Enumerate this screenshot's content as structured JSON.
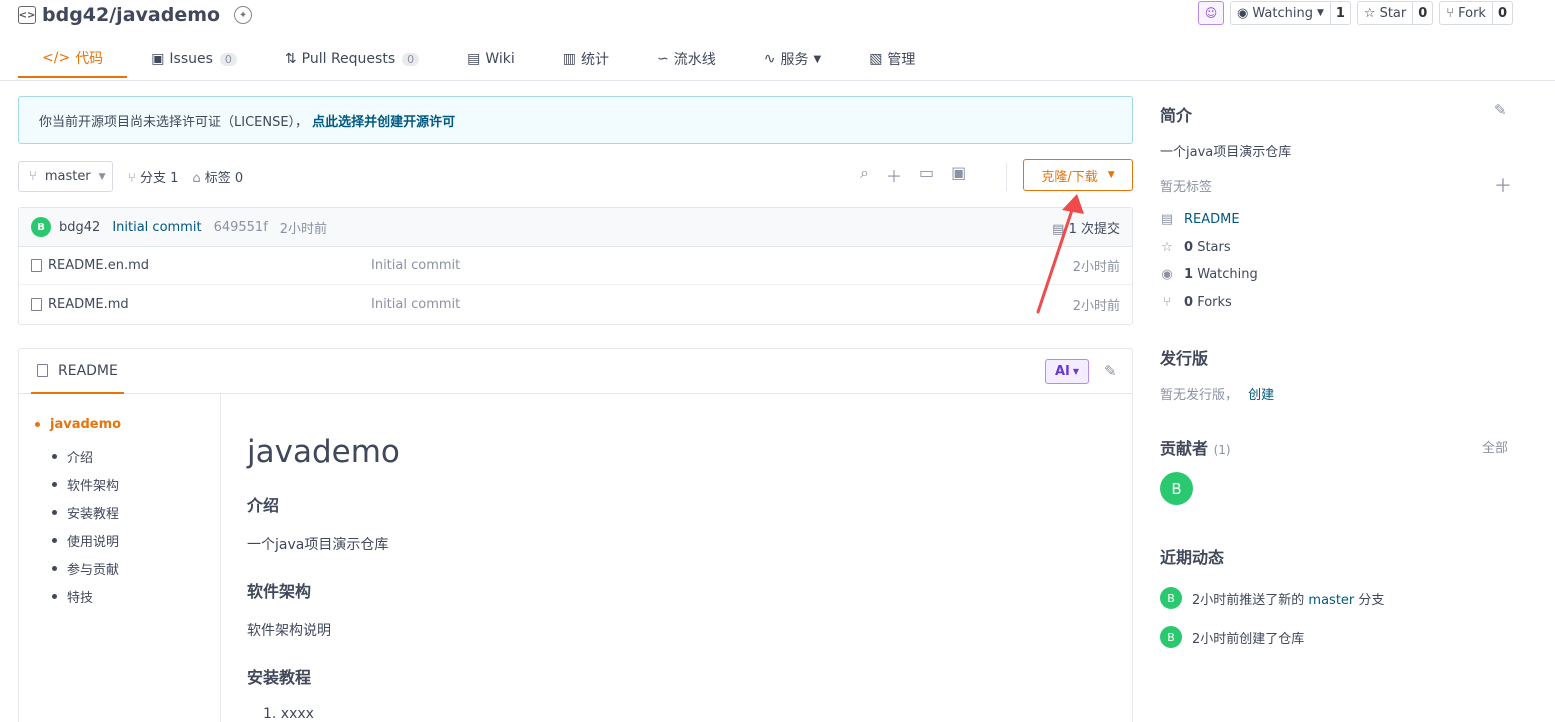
{
  "repo": {
    "title": "bdg42/javademo"
  },
  "top_actions": {
    "ai_icon": "robot-icon",
    "watching_label": "Watching",
    "watching_count": "1",
    "star_label": "Star",
    "star_count": "0",
    "fork_label": "Fork",
    "fork_count": "0"
  },
  "tabs": [
    {
      "label": "代码",
      "icon": "code-icon",
      "active": true
    },
    {
      "label": "Issues",
      "count": "0",
      "icon": "issues-icon"
    },
    {
      "label": "Pull Requests",
      "count": "0",
      "icon": "pull-request-icon"
    },
    {
      "label": "Wiki",
      "icon": "wiki-icon"
    },
    {
      "label": "统计",
      "icon": "chart-icon"
    },
    {
      "label": "流水线",
      "icon": "pipeline-icon"
    },
    {
      "label": "服务",
      "icon": "pulse-icon"
    },
    {
      "label": "管理",
      "icon": "manage-icon"
    }
  ],
  "license": {
    "text": "你当前开源项目尚未选择许可证（LICENSE），",
    "link": "点此选择并创建开源许可"
  },
  "branch": {
    "name": "master",
    "branches": "分支 1",
    "tags": "标签 0"
  },
  "clone_label": "克隆/下载",
  "commit": {
    "avatar": "B",
    "author": "bdg42",
    "message": "Initial commit",
    "hash": "649551f",
    "time": "2小时前",
    "count": "1 次提交"
  },
  "files": [
    {
      "name": "README.en.md",
      "message": "Initial commit",
      "time": "2小时前"
    },
    {
      "name": "README.md",
      "message": "Initial commit",
      "time": "2小时前"
    }
  ],
  "readme": {
    "tab": "README",
    "ai_label": "AI",
    "toc_root": "javademo",
    "toc": [
      "介绍",
      "软件架构",
      "安装教程",
      "使用说明",
      "参与贡献",
      "特技"
    ],
    "h1": "javademo",
    "s1_title": "介绍",
    "s1_text": "一个java项目演示仓库",
    "s2_title": "软件架构",
    "s2_text": "软件架构说明",
    "s3_title": "安装教程",
    "s3_item1": "1. xxxx"
  },
  "sidebar": {
    "intro_title": "简介",
    "intro_text": "一个java项目演示仓库",
    "no_tags": "暂无标签",
    "readme_link": "README",
    "stars_count": "0",
    "stars_label": "Stars",
    "watching_count": "1",
    "watching_label": "Watching",
    "forks_count": "0",
    "forks_label": "Forks",
    "release_title": "发行版",
    "release_text": "暂无发行版，",
    "release_create": "创建",
    "contrib_title": "贡献者",
    "contrib_count": "(1)",
    "contrib_all": "全部",
    "contrib_avatar": "B",
    "activity_title": "近期动态",
    "activity1_prefix": "2小时前推送了新的",
    "activity1_branch": "master",
    "activity1_suffix": "分支",
    "activity2": "2小时前创建了仓库",
    "activity_avatar": "B"
  },
  "colors": {
    "accent": "#e7740a",
    "link": "#005980",
    "avatar": "#2bc96f",
    "annotation_arrow": "#f04a4a"
  }
}
